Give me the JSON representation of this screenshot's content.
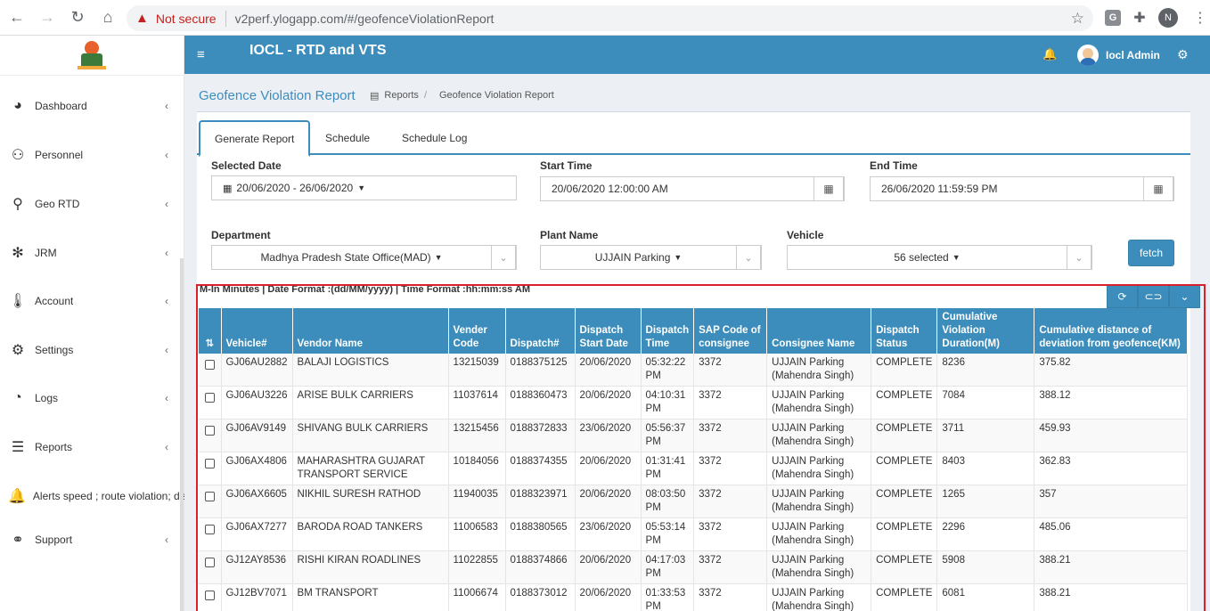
{
  "browser": {
    "not_secure": "Not secure",
    "url": "v2perf.ylogapp.com/#/geofenceViolationReport",
    "profile_initial": "N",
    "ext_g": "G"
  },
  "sidebar": {
    "items": [
      {
        "label": "Dashboard",
        "icon": "pie-chart-icon"
      },
      {
        "label": "Personnel",
        "icon": "users-icon"
      },
      {
        "label": "Geo RTD",
        "icon": "map-marker-icon"
      },
      {
        "label": "JRM",
        "icon": "gear-icon"
      },
      {
        "label": "Account",
        "icon": "thermometer-icon"
      },
      {
        "label": "Settings",
        "icon": "gear-icon"
      },
      {
        "label": "Logs",
        "icon": "clock-icon"
      },
      {
        "label": "Reports",
        "icon": "list-icon"
      },
      {
        "label": "Alerts speed ; route violation; distance",
        "icon": "bell-icon"
      },
      {
        "label": "Support",
        "icon": "link-icon"
      }
    ]
  },
  "header": {
    "title": "IOCL - RTD and VTS",
    "user": "Iocl Admin"
  },
  "page": {
    "title": "Geofence Violation Report",
    "breadcrumb": [
      "Reports",
      "Geofence Violation Report"
    ]
  },
  "tabs": [
    "Generate Report",
    "Schedule",
    "Schedule Log"
  ],
  "form": {
    "selected_date_label": "Selected Date",
    "selected_date_value": "20/06/2020 - 26/06/2020",
    "start_time_label": "Start Time",
    "start_time_value": "20/06/2020 12:00:00 AM",
    "end_time_label": "End Time",
    "end_time_value": "26/06/2020 11:59:59 PM",
    "department_label": "Department",
    "department_value": "Madhya Pradesh State Office(MAD)",
    "plant_label": "Plant Name",
    "plant_value": "UJJAIN Parking",
    "vehicle_label": "Vehicle",
    "vehicle_value": "56 selected",
    "fetch_label": "fetch"
  },
  "table": {
    "info": "M-In Minutes | Date Format :(dd/MM/yyyy) | Time Format :hh:mm:ss AM",
    "headers": [
      "Vehicle#",
      "Vendor Name",
      "Vender Code",
      "Dispatch#",
      "Dispatch Start Date",
      "Dispatch Time",
      "SAP Code of consignee",
      "Consignee Name",
      "Dispatch Status",
      "Cumulative Violation Duration(M)",
      "Cumulative distance of deviation from geofence(KM)"
    ],
    "rows": [
      [
        "GJ06AU2882",
        "BALAJI LOGISTICS",
        "13215039",
        "0188375125",
        "20/06/2020",
        "05:32:22 PM",
        "3372",
        "UJJAIN Parking (Mahendra Singh)",
        "COMPLETE",
        "8236",
        "375.82"
      ],
      [
        "GJ06AU3226",
        "ARISE BULK CARRIERS",
        "11037614",
        "0188360473",
        "20/06/2020",
        "04:10:31 PM",
        "3372",
        "UJJAIN Parking (Mahendra Singh)",
        "COMPLETE",
        "7084",
        "388.12"
      ],
      [
        "GJ06AV9149",
        "SHIVANG BULK CARRIERS",
        "13215456",
        "0188372833",
        "23/06/2020",
        "05:56:37 PM",
        "3372",
        "UJJAIN Parking (Mahendra Singh)",
        "COMPLETE",
        "3711",
        "459.93"
      ],
      [
        "GJ06AX4806",
        "MAHARASHTRA GUJARAT TRANSPORT SERVICE",
        "10184056",
        "0188374355",
        "20/06/2020",
        "01:31:41 PM",
        "3372",
        "UJJAIN Parking (Mahendra Singh)",
        "COMPLETE",
        "8403",
        "362.83"
      ],
      [
        "GJ06AX6605",
        "NIKHIL SURESH RATHOD",
        "11940035",
        "0188323971",
        "20/06/2020",
        "08:03:50 PM",
        "3372",
        "UJJAIN Parking (Mahendra Singh)",
        "COMPLETE",
        "1265",
        "357"
      ],
      [
        "GJ06AX7277",
        "BARODA ROAD TANKERS",
        "11006583",
        "0188380565",
        "23/06/2020",
        "05:53:14 PM",
        "3372",
        "UJJAIN Parking (Mahendra Singh)",
        "COMPLETE",
        "2296",
        "485.06"
      ],
      [
        "GJ12AY8536",
        "RISHI KIRAN ROADLINES",
        "11022855",
        "0188374866",
        "20/06/2020",
        "04:17:03 PM",
        "3372",
        "UJJAIN Parking (Mahendra Singh)",
        "COMPLETE",
        "5908",
        "388.21"
      ],
      [
        "GJ12BV7071",
        "BM TRANSPORT",
        "11006674",
        "0188373012",
        "20/06/2020",
        "01:33:53 PM",
        "3372",
        "UJJAIN Parking (Mahendra Singh)",
        "COMPLETE",
        "6081",
        "388.21"
      ]
    ]
  }
}
